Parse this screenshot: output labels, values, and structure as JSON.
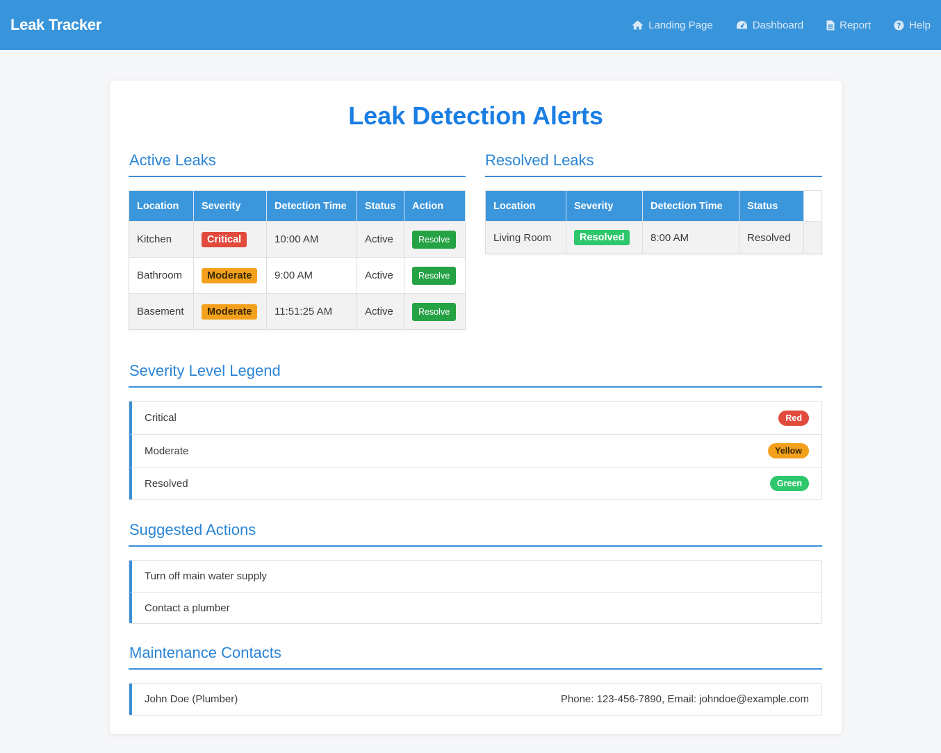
{
  "app": {
    "brand": "Leak Tracker"
  },
  "nav": [
    {
      "label": "Landing Page",
      "icon": "home-icon"
    },
    {
      "label": "Dashboard",
      "icon": "dashboard-icon"
    },
    {
      "label": "Report",
      "icon": "document-icon"
    },
    {
      "label": "Help",
      "icon": "question-icon"
    }
  ],
  "page": {
    "title": "Leak Detection Alerts"
  },
  "active": {
    "heading": "Active Leaks",
    "columns": [
      "Location",
      "Severity",
      "Detection Time",
      "Status",
      "Action"
    ],
    "rows": [
      {
        "location": "Kitchen",
        "severity": "Critical",
        "time": "10:00 AM",
        "status": "Active",
        "action": "Resolve"
      },
      {
        "location": "Bathroom",
        "severity": "Moderate",
        "time": "9:00 AM",
        "status": "Active",
        "action": "Resolve"
      },
      {
        "location": "Basement",
        "severity": "Moderate",
        "time": "11:51:25 AM",
        "status": "Active",
        "action": "Resolve"
      }
    ]
  },
  "resolved": {
    "heading": "Resolved Leaks",
    "columns": [
      "Location",
      "Severity",
      "Detection Time",
      "Status"
    ],
    "rows": [
      {
        "location": "Living Room",
        "severity": "Resolved",
        "time": "8:00 AM",
        "status": "Resolved"
      }
    ]
  },
  "legend": {
    "heading": "Severity Level Legend",
    "items": [
      {
        "level": "Critical",
        "color": "Red"
      },
      {
        "level": "Moderate",
        "color": "Yellow"
      },
      {
        "level": "Resolved",
        "color": "Green"
      }
    ]
  },
  "actions": {
    "heading": "Suggested Actions",
    "items": [
      "Turn off main water supply",
      "Contact a plumber"
    ]
  },
  "contacts": {
    "heading": "Maintenance Contacts",
    "items": [
      {
        "name": "John Doe (Plumber)",
        "details": "Phone: 123-456-7890, Email: johndoe@example.com"
      }
    ]
  },
  "colors": {
    "navbar": "#3995db",
    "accent": "#1a7ee4",
    "critical": "#e14a3d",
    "moderate": "#f3a11c",
    "resolved": "#2ec76b",
    "resolve_button": "#25a244"
  }
}
